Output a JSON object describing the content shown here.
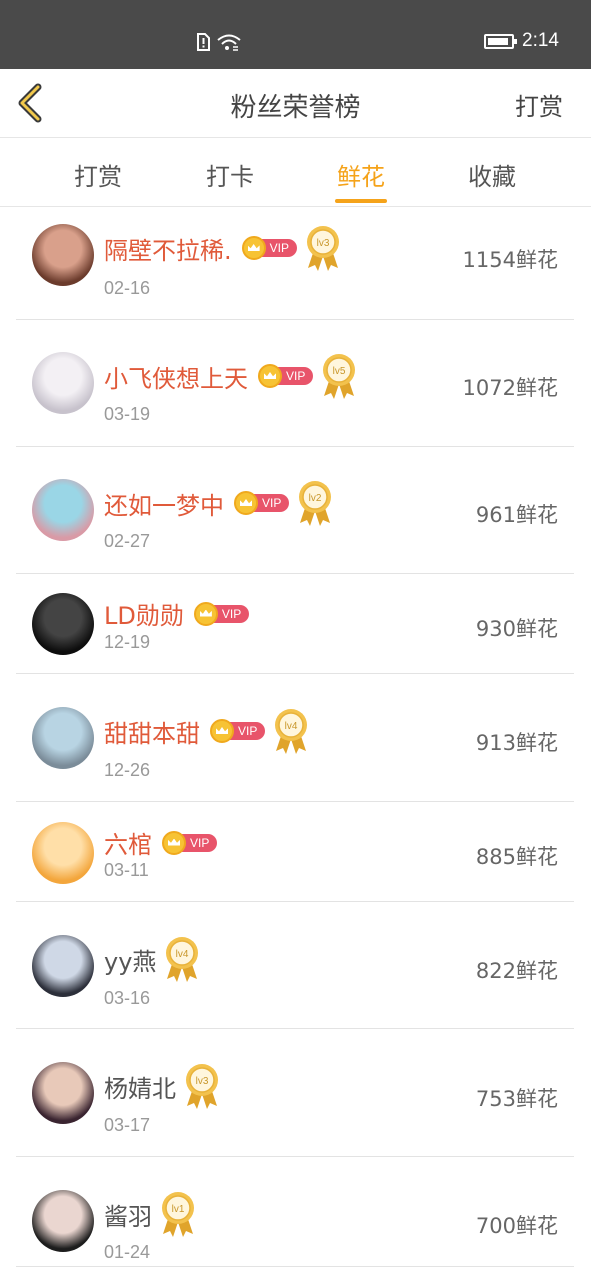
{
  "status_bar": {
    "time": "2:14",
    "battery_level": 0.9
  },
  "header": {
    "title": "粉丝荣誉榜",
    "action_label": "打赏",
    "back_icon": "chevron-left-icon"
  },
  "tabs": [
    {
      "label": "打赏",
      "active": false
    },
    {
      "label": "打卡",
      "active": false
    },
    {
      "label": "鲜花",
      "active": true
    },
    {
      "label": "收藏",
      "active": false
    }
  ],
  "colors": {
    "accent": "#f5a31a",
    "vip_name": "#e05a3a",
    "vip_tag": "#e8546a"
  },
  "fans": [
    {
      "name": "隔壁不拉稀.",
      "vip": true,
      "vip_label": "VIP",
      "level": "lv3",
      "date": "02-16",
      "count": "1154鲜花"
    },
    {
      "name": "小飞侠想上天",
      "vip": true,
      "vip_label": "VIP",
      "level": "lv5",
      "date": "03-19",
      "count": "1072鲜花"
    },
    {
      "name": "还如一梦中",
      "vip": true,
      "vip_label": "VIP",
      "level": "lv2",
      "date": "02-27",
      "count": "961鲜花"
    },
    {
      "name": "LD勋勋",
      "vip": true,
      "vip_label": "VIP",
      "level": "",
      "date": "12-19",
      "count": "930鲜花"
    },
    {
      "name": "甜甜本甜",
      "vip": true,
      "vip_label": "VIP",
      "level": "lv4",
      "date": "12-26",
      "count": "913鲜花"
    },
    {
      "name": "六棺",
      "vip": true,
      "vip_label": "VIP",
      "level": "",
      "date": "03-11",
      "count": "885鲜花"
    },
    {
      "name": "yy燕",
      "vip": false,
      "vip_label": "",
      "level": "lv4",
      "date": "03-16",
      "count": "822鲜花"
    },
    {
      "name": "杨婧北",
      "vip": false,
      "vip_label": "",
      "level": "lv3",
      "date": "03-17",
      "count": "753鲜花"
    },
    {
      "name": "酱羽",
      "vip": false,
      "vip_label": "",
      "level": "lv1",
      "date": "01-24",
      "count": "700鲜花"
    }
  ]
}
